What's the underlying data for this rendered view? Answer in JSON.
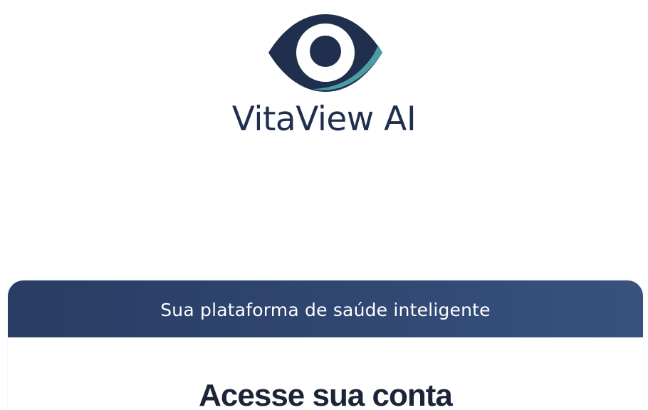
{
  "brand": {
    "name": "VitaView AI",
    "logo_icon": "eye-icon",
    "colors": {
      "navy": "#1f2f4d",
      "teal": "#4a9ea3",
      "white": "#ffffff"
    }
  },
  "card": {
    "tagline": "Sua plataforma de saúde inteligente",
    "title": "Acesse sua conta",
    "header_gradient": [
      "#283d63",
      "#38527f"
    ]
  }
}
